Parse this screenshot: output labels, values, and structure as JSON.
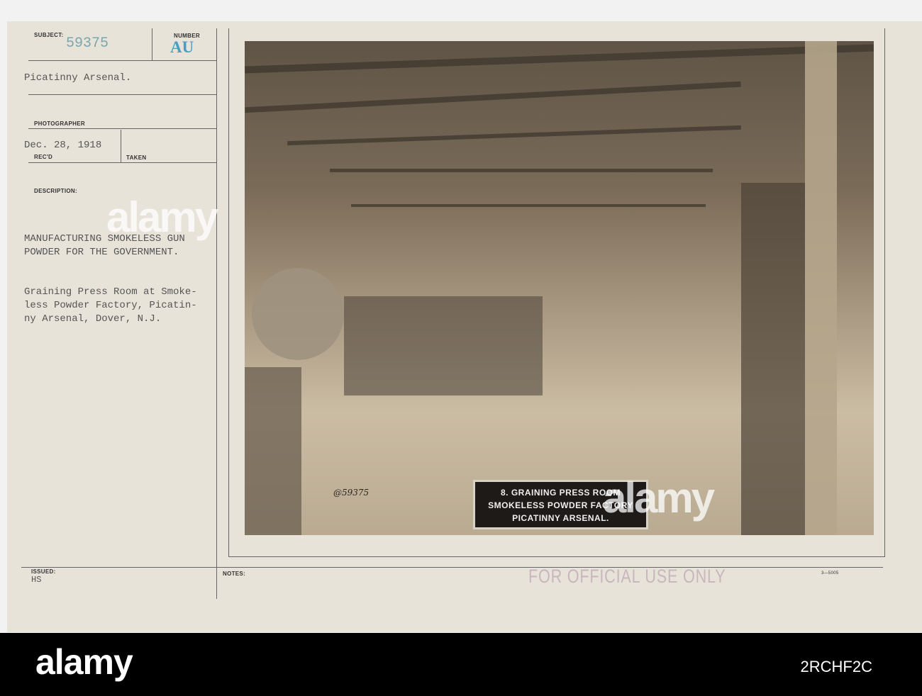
{
  "card": {
    "subject_label": "SUBJECT:",
    "subject_number": "59375",
    "number_label": "NUMBER",
    "number_value": "AU",
    "location": "Picatinny Arsenal.",
    "photographer_label": "PHOTOGRAPHER",
    "date": "Dec. 28, 1918",
    "recd_label": "REC'D",
    "taken_label": "TAKEN",
    "description_label": "DESCRIPTION:",
    "description_title": "MANUFACTURING SMOKELESS GUN\nPOWDER FOR THE GOVERNMENT.",
    "description_body": "Graining Press Room at Smoke-\nless Powder Factory, Picatin-\nny Arsenal, Dover, N.J.",
    "issued_label": "ISSUED:",
    "issued_value": "HS",
    "notes_label": "NOTES:",
    "stamp": "FOR OFFICIAL USE ONLY",
    "form_number": "3—5005"
  },
  "photo": {
    "caption_lines": [
      "8.  GRAINING PRESS ROOM",
      "SMOKELESS POWDER FACTORY",
      "PICATINNY  ARSENAL."
    ],
    "handwritten_number": "@59375"
  },
  "footer": {
    "logo": "alamy",
    "image_id": "2RCHF2C",
    "watermark": "alamy"
  }
}
